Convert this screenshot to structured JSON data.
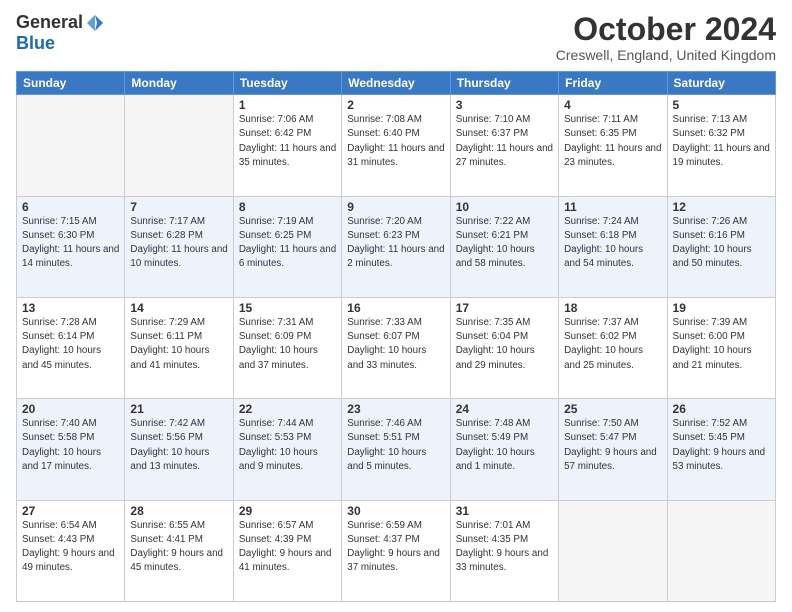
{
  "header": {
    "logo_general": "General",
    "logo_blue": "Blue",
    "month_title": "October 2024",
    "location": "Creswell, England, United Kingdom"
  },
  "weekdays": [
    "Sunday",
    "Monday",
    "Tuesday",
    "Wednesday",
    "Thursday",
    "Friday",
    "Saturday"
  ],
  "weeks": [
    [
      {
        "day": "",
        "info": ""
      },
      {
        "day": "",
        "info": ""
      },
      {
        "day": "1",
        "info": "Sunrise: 7:06 AM\nSunset: 6:42 PM\nDaylight: 11 hours and 35 minutes."
      },
      {
        "day": "2",
        "info": "Sunrise: 7:08 AM\nSunset: 6:40 PM\nDaylight: 11 hours and 31 minutes."
      },
      {
        "day": "3",
        "info": "Sunrise: 7:10 AM\nSunset: 6:37 PM\nDaylight: 11 hours and 27 minutes."
      },
      {
        "day": "4",
        "info": "Sunrise: 7:11 AM\nSunset: 6:35 PM\nDaylight: 11 hours and 23 minutes."
      },
      {
        "day": "5",
        "info": "Sunrise: 7:13 AM\nSunset: 6:32 PM\nDaylight: 11 hours and 19 minutes."
      }
    ],
    [
      {
        "day": "6",
        "info": "Sunrise: 7:15 AM\nSunset: 6:30 PM\nDaylight: 11 hours and 14 minutes."
      },
      {
        "day": "7",
        "info": "Sunrise: 7:17 AM\nSunset: 6:28 PM\nDaylight: 11 hours and 10 minutes."
      },
      {
        "day": "8",
        "info": "Sunrise: 7:19 AM\nSunset: 6:25 PM\nDaylight: 11 hours and 6 minutes."
      },
      {
        "day": "9",
        "info": "Sunrise: 7:20 AM\nSunset: 6:23 PM\nDaylight: 11 hours and 2 minutes."
      },
      {
        "day": "10",
        "info": "Sunrise: 7:22 AM\nSunset: 6:21 PM\nDaylight: 10 hours and 58 minutes."
      },
      {
        "day": "11",
        "info": "Sunrise: 7:24 AM\nSunset: 6:18 PM\nDaylight: 10 hours and 54 minutes."
      },
      {
        "day": "12",
        "info": "Sunrise: 7:26 AM\nSunset: 6:16 PM\nDaylight: 10 hours and 50 minutes."
      }
    ],
    [
      {
        "day": "13",
        "info": "Sunrise: 7:28 AM\nSunset: 6:14 PM\nDaylight: 10 hours and 45 minutes."
      },
      {
        "day": "14",
        "info": "Sunrise: 7:29 AM\nSunset: 6:11 PM\nDaylight: 10 hours and 41 minutes."
      },
      {
        "day": "15",
        "info": "Sunrise: 7:31 AM\nSunset: 6:09 PM\nDaylight: 10 hours and 37 minutes."
      },
      {
        "day": "16",
        "info": "Sunrise: 7:33 AM\nSunset: 6:07 PM\nDaylight: 10 hours and 33 minutes."
      },
      {
        "day": "17",
        "info": "Sunrise: 7:35 AM\nSunset: 6:04 PM\nDaylight: 10 hours and 29 minutes."
      },
      {
        "day": "18",
        "info": "Sunrise: 7:37 AM\nSunset: 6:02 PM\nDaylight: 10 hours and 25 minutes."
      },
      {
        "day": "19",
        "info": "Sunrise: 7:39 AM\nSunset: 6:00 PM\nDaylight: 10 hours and 21 minutes."
      }
    ],
    [
      {
        "day": "20",
        "info": "Sunrise: 7:40 AM\nSunset: 5:58 PM\nDaylight: 10 hours and 17 minutes."
      },
      {
        "day": "21",
        "info": "Sunrise: 7:42 AM\nSunset: 5:56 PM\nDaylight: 10 hours and 13 minutes."
      },
      {
        "day": "22",
        "info": "Sunrise: 7:44 AM\nSunset: 5:53 PM\nDaylight: 10 hours and 9 minutes."
      },
      {
        "day": "23",
        "info": "Sunrise: 7:46 AM\nSunset: 5:51 PM\nDaylight: 10 hours and 5 minutes."
      },
      {
        "day": "24",
        "info": "Sunrise: 7:48 AM\nSunset: 5:49 PM\nDaylight: 10 hours and 1 minute."
      },
      {
        "day": "25",
        "info": "Sunrise: 7:50 AM\nSunset: 5:47 PM\nDaylight: 9 hours and 57 minutes."
      },
      {
        "day": "26",
        "info": "Sunrise: 7:52 AM\nSunset: 5:45 PM\nDaylight: 9 hours and 53 minutes."
      }
    ],
    [
      {
        "day": "27",
        "info": "Sunrise: 6:54 AM\nSunset: 4:43 PM\nDaylight: 9 hours and 49 minutes."
      },
      {
        "day": "28",
        "info": "Sunrise: 6:55 AM\nSunset: 4:41 PM\nDaylight: 9 hours and 45 minutes."
      },
      {
        "day": "29",
        "info": "Sunrise: 6:57 AM\nSunset: 4:39 PM\nDaylight: 9 hours and 41 minutes."
      },
      {
        "day": "30",
        "info": "Sunrise: 6:59 AM\nSunset: 4:37 PM\nDaylight: 9 hours and 37 minutes."
      },
      {
        "day": "31",
        "info": "Sunrise: 7:01 AM\nSunset: 4:35 PM\nDaylight: 9 hours and 33 minutes."
      },
      {
        "day": "",
        "info": ""
      },
      {
        "day": "",
        "info": ""
      }
    ]
  ]
}
